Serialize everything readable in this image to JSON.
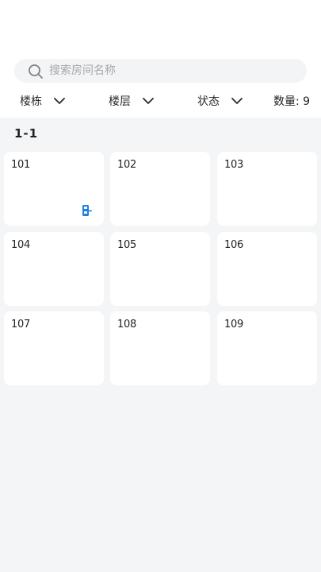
{
  "search": {
    "placeholder": "搜索房间名称",
    "value": ""
  },
  "filters": {
    "building_label": "楼栋",
    "floor_label": "楼层",
    "status_label": "状态"
  },
  "count_text": "数量: 9",
  "group": {
    "title": "1-1"
  },
  "rooms": [
    {
      "number": "101",
      "has_lock": true
    },
    {
      "number": "102",
      "has_lock": false
    },
    {
      "number": "103",
      "has_lock": false
    },
    {
      "number": "104",
      "has_lock": false
    },
    {
      "number": "105",
      "has_lock": false
    },
    {
      "number": "106",
      "has_lock": false
    },
    {
      "number": "107",
      "has_lock": false
    },
    {
      "number": "108",
      "has_lock": false
    },
    {
      "number": "109",
      "has_lock": false
    }
  ],
  "colors": {
    "accent": "#1f7fe5",
    "card": "#ffffff",
    "background": "#f4f5f7"
  }
}
